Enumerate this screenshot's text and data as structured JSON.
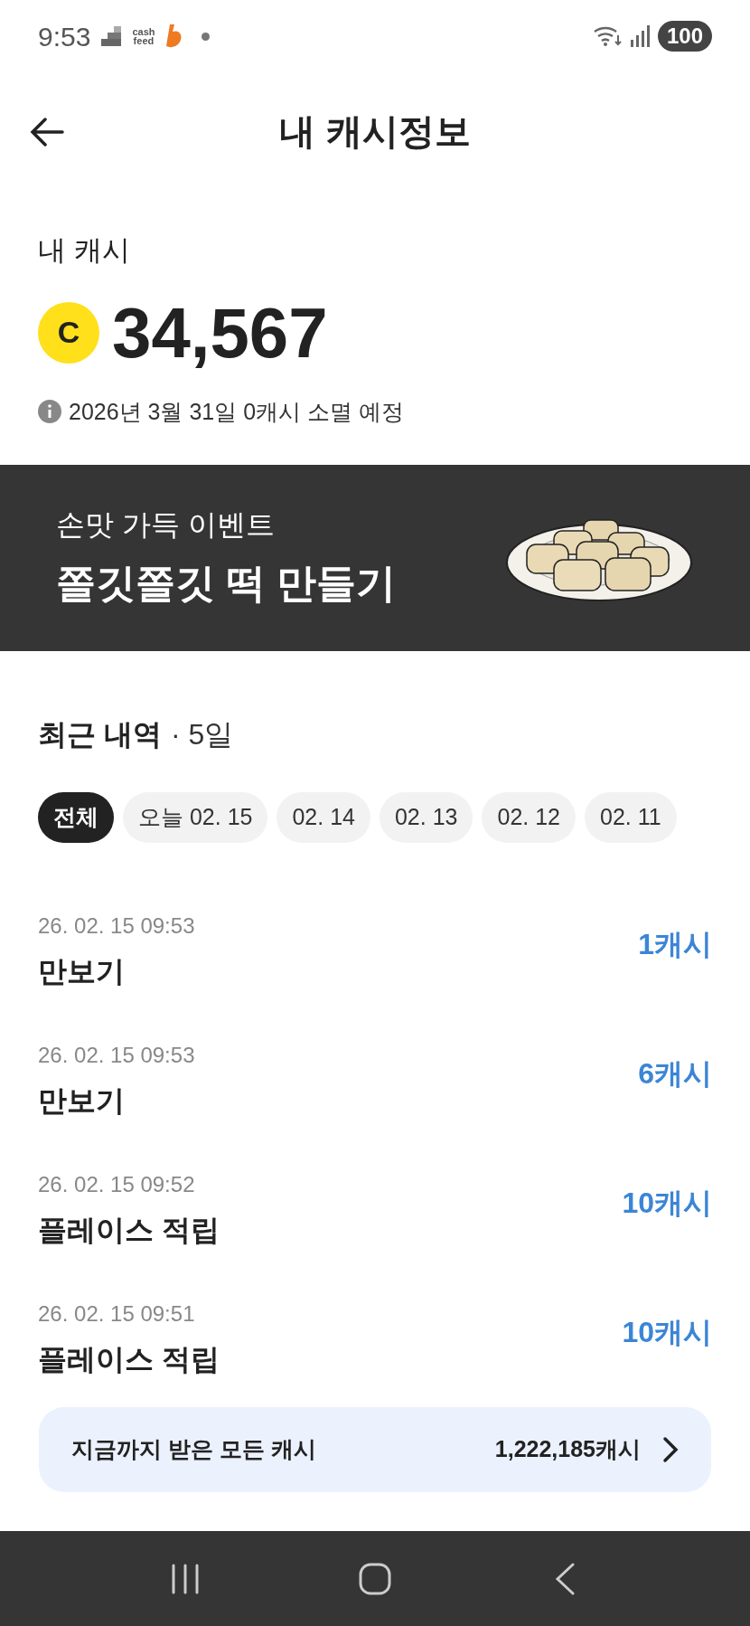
{
  "status_bar": {
    "time": "9:53",
    "logo_text": [
      "cash",
      "feed"
    ],
    "battery": "100"
  },
  "header": {
    "title": "내 캐시정보"
  },
  "balance": {
    "label": "내 캐시",
    "coin": "C",
    "amount": "34,567",
    "notice": "2026년 3월 31일 0캐시 소멸 예정"
  },
  "banner": {
    "subtitle": "손맛 가득 이벤트",
    "title": "쫄깃쫄깃 떡 만들기"
  },
  "recent": {
    "title": "최근 내역",
    "separator": "·",
    "period": "5일",
    "filters": [
      {
        "label": "전체",
        "selected": true
      },
      {
        "label": "오늘 02. 15",
        "selected": false
      },
      {
        "label": "02. 14",
        "selected": false
      },
      {
        "label": "02. 13",
        "selected": false
      },
      {
        "label": "02. 12",
        "selected": false
      },
      {
        "label": "02. 11",
        "selected": false
      }
    ],
    "items": [
      {
        "date": "26. 02. 15 09:53",
        "title": "만보기",
        "amount": "1캐시"
      },
      {
        "date": "26. 02. 15 09:53",
        "title": "만보기",
        "amount": "6캐시"
      },
      {
        "date": "26. 02. 15 09:52",
        "title": "플레이스 적립",
        "amount": "10캐시"
      },
      {
        "date": "26. 02. 15 09:51",
        "title": "플레이스 적립",
        "amount": "10캐시"
      }
    ]
  },
  "total_button": {
    "label": "지금까지 받은 모든 캐시",
    "amount": "1,222,185캐시"
  }
}
